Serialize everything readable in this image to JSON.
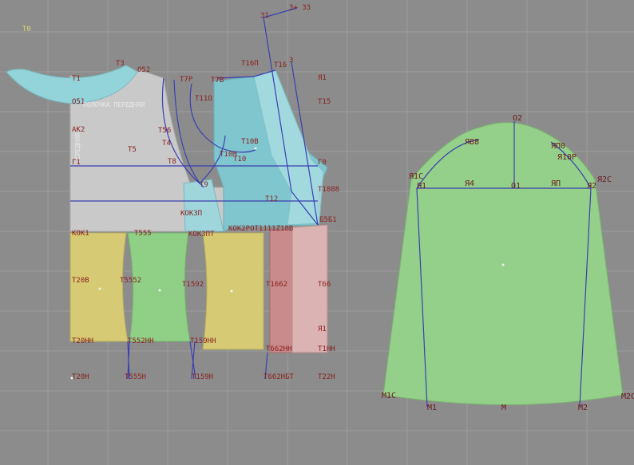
{
  "app": {
    "name": "",
    "accent": "#4a52c8"
  },
  "colors": {
    "background": "#8c8c8c",
    "grid": "#9a9a9a",
    "piece_front_body": "#c9c9c9",
    "piece_collar": "#8fd0d8",
    "piece_side_panel": "#7fc6cf",
    "piece_yellow": "#d8cc74",
    "piece_green": "#8fcf86",
    "piece_pink": "#d8a8a8",
    "piece_pink_dark": "#c98b8b",
    "piece_sleeve": "#94d08a",
    "construction_line": "#3b3fb0",
    "point_label": "#8a1f1f"
  },
  "labels": {
    "t0": "T0",
    "t3": "T3",
    "o52": "O52",
    "t1": "T1",
    "t7p": "T7P",
    "t7b": "T7B",
    "t16p": "T16П",
    "t16": "T16",
    "p31": "31",
    "p3": "3",
    "p33": "3+ 33",
    "r1": "Я1",
    "t15": "T15",
    "o51": "O51",
    "t11o": "T11O",
    "ak2": "AK2",
    "t56": "T56",
    "t4": "T4",
    "t5": "T5",
    "t10b": "T10B",
    "t10m": "T10M",
    "t10": "T10",
    "t8": "T8",
    "t9": "T9",
    "g1": "Г1",
    "g0": "Г0",
    "t12": "T12",
    "t1888": "T1888",
    "kokzp": "KOKЗП",
    "b5b1": "Б5Б1",
    "kok1": "KOK1",
    "t555": "T555",
    "kokzpt": "KOKЗПT",
    "kok2po": "KOK2POT1111Z18B",
    "t20b": "T20B",
    "t5552": "T5552",
    "t1592": "T1592",
    "t1662": "T1662",
    "t66": "T66",
    "t20hh": "T20HH",
    "t552hh": "T552HH",
    "t159hh": "T159HH",
    "t662hh": "T662HH",
    "t11hh": "T1HH",
    "p1t1": "Я1",
    "t20h": "T20H",
    "t555h": "T555H",
    "t159h": "T159H",
    "t662h": "T662HБT",
    "t22h": "T22H",
    "sleeve_o2": "O2",
    "sleeve_r88": "Я88",
    "sleeve_r8o": "ЯП0",
    "sleeve_r10p": "Я10P",
    "sleeve_r1c": "Я1C",
    "sleeve_r1": "Я1",
    "sleeve_r4": "Я4",
    "sleeve_o1": "O1",
    "sleeve_rp": "ЯП",
    "sleeve_r2": "Я2",
    "sleeve_r2c": "Я2C",
    "sleeve_m1c": "M1C",
    "sleeve_m1": "M1",
    "sleeve_m": "M",
    "sleeve_m2": "M2",
    "sleeve_m2c": "M2C",
    "side_vert_text": "СPEДНЯЯ",
    "front_text": "ПОЛОЧКА ПЕРЕДНЯЯ"
  }
}
